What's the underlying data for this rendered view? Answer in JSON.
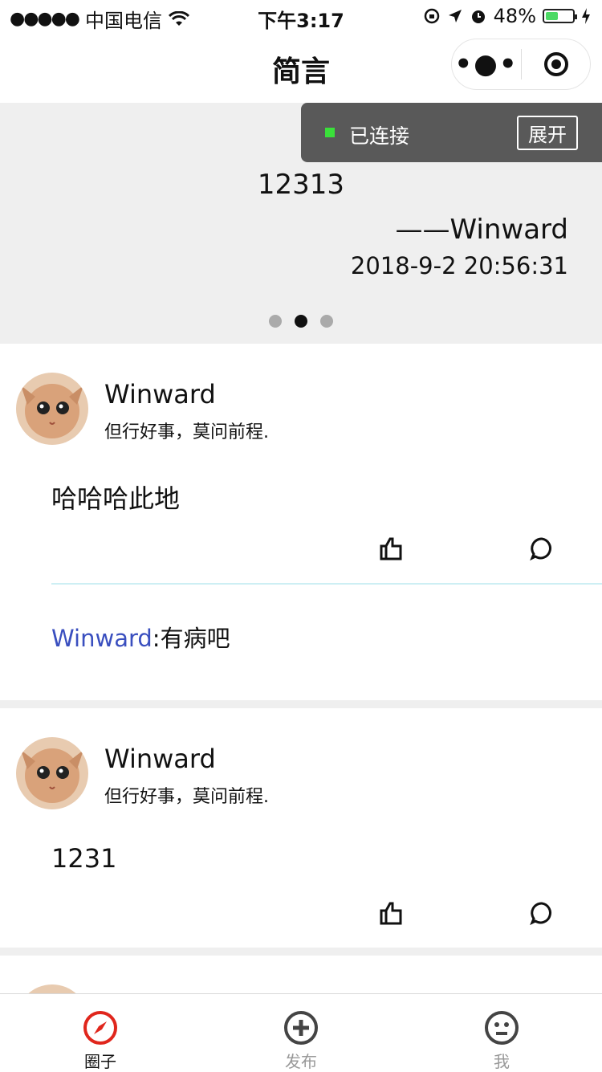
{
  "status_bar": {
    "carrier": "中国电信",
    "time": "下午3:17",
    "battery": "48%",
    "battery_level": 0.48
  },
  "nav": {
    "title": "简言"
  },
  "toast": {
    "status_text": "已连接",
    "expand_label": "展开"
  },
  "banner": {
    "quote": "12313",
    "author": "——Winward",
    "date": "2018-9-2 20:56:31",
    "active_index": 1
  },
  "posts": [
    {
      "username": "Winward",
      "motto": "但行好事，莫问前程.",
      "content": "哈哈哈此地",
      "comments": [
        {
          "author": "Winward",
          "sep": ":",
          "text": "有病吧"
        }
      ]
    },
    {
      "username": "Winward",
      "motto": "但行好事，莫问前程.",
      "content": "1231",
      "comments": []
    }
  ],
  "tabbar": {
    "tabs": [
      {
        "label": "圈子",
        "icon": "compass-icon",
        "active": true
      },
      {
        "label": "发布",
        "icon": "add-icon",
        "active": false
      },
      {
        "label": "我",
        "icon": "face-icon",
        "active": false
      }
    ]
  },
  "colors": {
    "banner_bg": "#efefef",
    "toast_bg": "#595959",
    "connected": "#3ae03a",
    "active_tab": "#e0261c",
    "comment_author": "#3a4fbf"
  }
}
